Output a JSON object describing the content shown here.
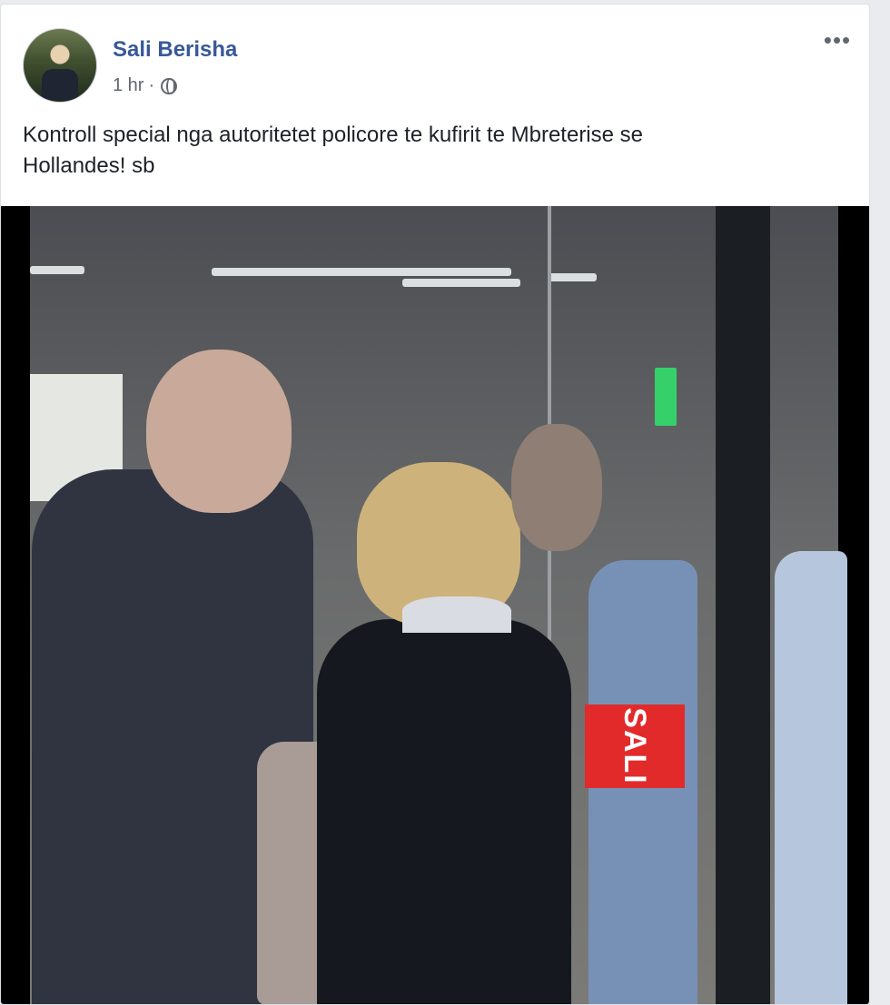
{
  "post": {
    "author_name": "Sali Berisha",
    "timestamp": "1 hr",
    "separator": "·",
    "privacy_icon": "globe-icon",
    "more_icon": "•••",
    "text_line1": "Kontroll special nga autoritetet policore te kufirit te Mbreterise se",
    "text_line2": "Hollandes! sb"
  },
  "photo": {
    "sign_text": "SALI"
  },
  "colors": {
    "author_link": "#385898",
    "meta_text": "#616770",
    "body_text": "#1d2129",
    "card_bg": "#ffffff",
    "page_bg": "#e9ebee"
  }
}
